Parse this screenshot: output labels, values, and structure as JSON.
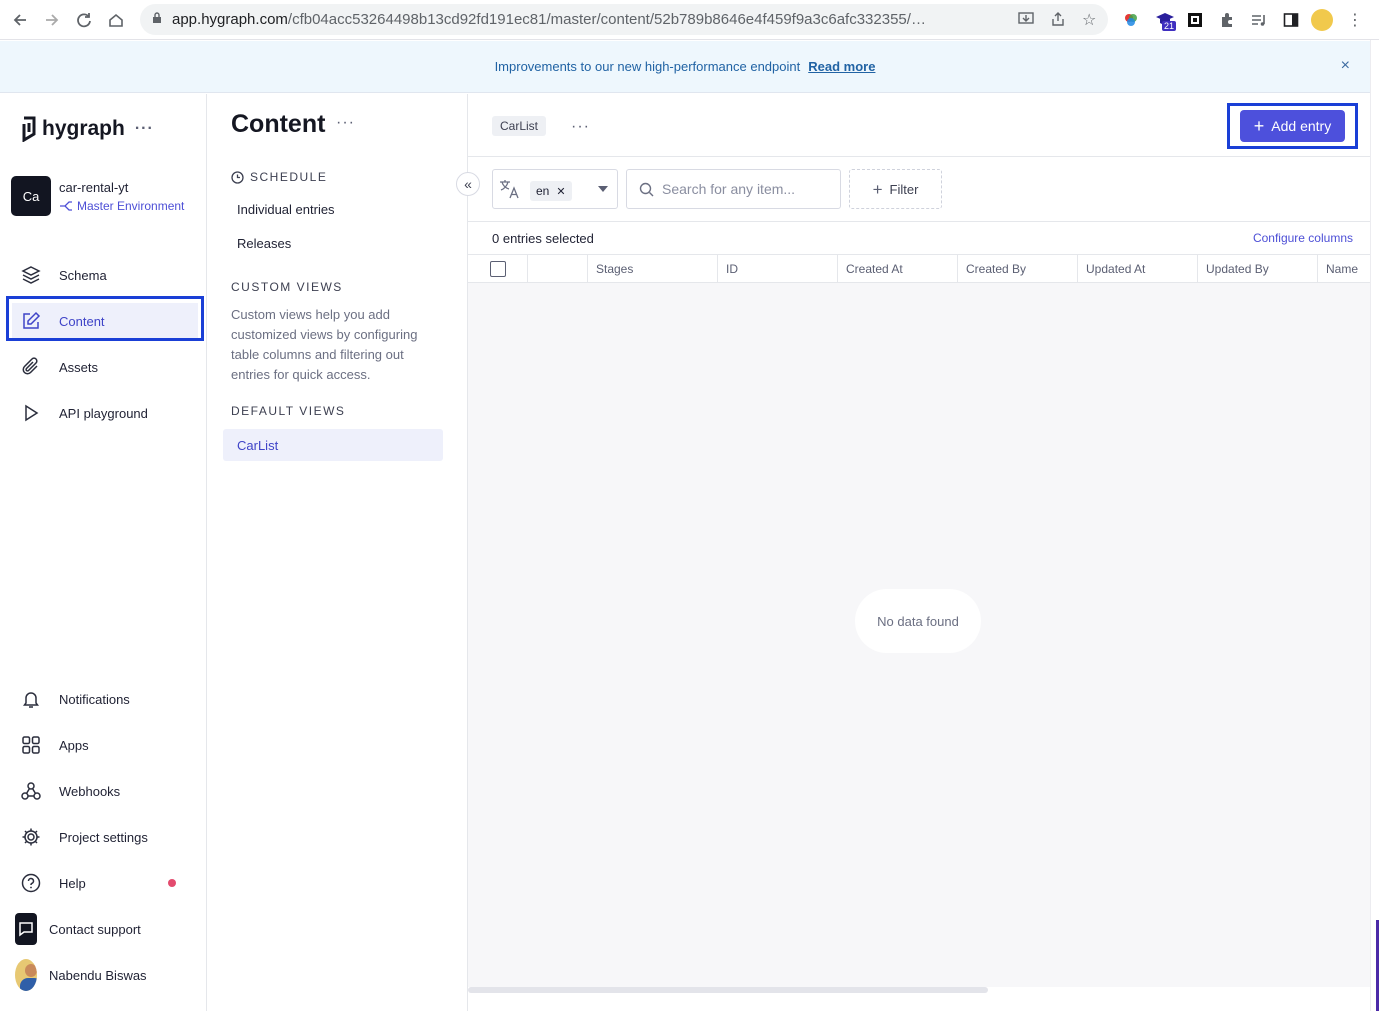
{
  "browser": {
    "url_host": "app.hygraph.com",
    "url_path": "/cfb04acc53264498b13cd92fd191ec81/master/content/52b789b8646e4f459f9a3c6afc332355/view/1c23...",
    "extension_badge": "21"
  },
  "banner": {
    "text": "Improvements to our new high-performance endpoint",
    "link": "Read more",
    "close": "×"
  },
  "sidebar": {
    "logo": "hygraph",
    "menu_dots": "···",
    "project": {
      "initials": "Ca",
      "name": "car-rental-yt",
      "environment": "Master Environment"
    },
    "items": [
      {
        "label": "Schema",
        "icon": "layers-icon"
      },
      {
        "label": "Content",
        "icon": "edit-icon",
        "active": true
      },
      {
        "label": "Assets",
        "icon": "paperclip-icon"
      },
      {
        "label": "API playground",
        "icon": "play-icon"
      }
    ],
    "bottom_items": [
      {
        "label": "Notifications",
        "icon": "bell-icon"
      },
      {
        "label": "Apps",
        "icon": "apps-icon"
      },
      {
        "label": "Webhooks",
        "icon": "webhook-icon"
      },
      {
        "label": "Project settings",
        "icon": "gear-icon"
      },
      {
        "label": "Help",
        "icon": "help-icon"
      },
      {
        "label": "Contact support",
        "icon": "chat-icon"
      },
      {
        "label": "Nabendu Biswas",
        "icon": "avatar"
      }
    ]
  },
  "content_panel": {
    "title": "Content",
    "menu_dots": "···",
    "schedule_heading": "SCHEDULE",
    "schedule_links": [
      "Individual entries",
      "Releases"
    ],
    "custom_views_heading": "CUSTOM VIEWS",
    "custom_views_description": "Custom views help you add customized views by configuring table columns and filtering out entries for quick access.",
    "default_views_heading": "DEFAULT VIEWS",
    "default_views": [
      "CarList"
    ],
    "collapse": "«"
  },
  "main": {
    "view_tag": "CarList",
    "menu_dots": "···",
    "add_entry": "Add entry",
    "locale": "en",
    "search_placeholder": "Search for any item...",
    "filter": "Filter",
    "selected_count": "0 entries selected",
    "configure_columns": "Configure columns",
    "columns": [
      "Stages",
      "ID",
      "Created At",
      "Created By",
      "Updated At",
      "Updated By",
      "Name"
    ],
    "empty_message": "No data found"
  },
  "colors": {
    "accent": "#4d50dc",
    "highlight_border": "#1a3fd6",
    "banner_bg": "#eef7fd",
    "help_dot": "#e34b6e"
  }
}
